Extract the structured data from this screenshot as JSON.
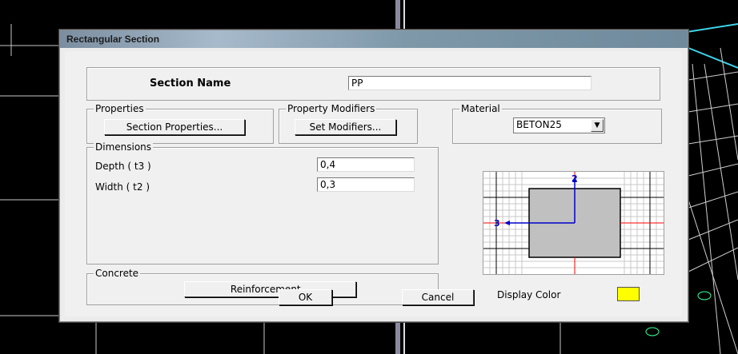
{
  "window": {
    "title": "Rectangular Section"
  },
  "section_name": {
    "label": "Section Name",
    "value": "PP"
  },
  "properties": {
    "group_label": "Properties",
    "button": "Section Properties..."
  },
  "modifiers": {
    "group_label": "Property Modifiers",
    "button": "Set Modifiers..."
  },
  "material": {
    "group_label": "Material",
    "selected": "BETON25",
    "arrow_icon": "chevron-down-icon"
  },
  "dimensions": {
    "group_label": "Dimensions",
    "depth": {
      "label": "Depth  ( t3 )",
      "value": "0,4"
    },
    "width": {
      "label": "Width  ( t2 )",
      "value": "0,3"
    }
  },
  "preview": {
    "axis_2": "2",
    "axis_3": "3"
  },
  "concrete": {
    "group_label": "Concrete",
    "button": "Reinforcement..."
  },
  "display_color": {
    "label": "Display Color",
    "color": "#ffff00"
  },
  "actions": {
    "ok": "OK",
    "cancel": "Cancel"
  },
  "colors": {
    "titlebar": "#8fa3b5",
    "section_fill": "#c0c0c0",
    "axis_blue": "#0000cc",
    "axis_red": "#ff0000"
  }
}
